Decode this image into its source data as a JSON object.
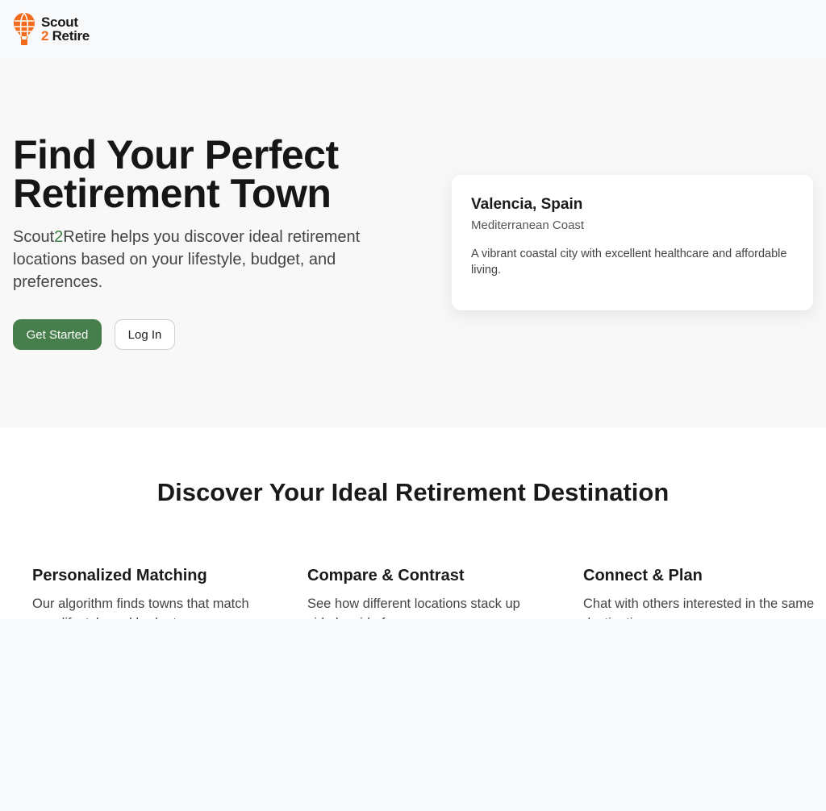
{
  "logo": {
    "line1": "Scout",
    "line2_num": "2",
    "line2_word": " Retire",
    "icon": "hot-air-balloon-icon",
    "colors": {
      "balloon": "#f26a1b"
    }
  },
  "hero": {
    "title": "Find Your Perfect Retirement Town",
    "subtitle_pre": "Scout",
    "subtitle_num": "2",
    "subtitle_post": "Retire helps you discover ideal retirement locations based on your lifestyle, budget, and preferences.",
    "primary_button": "Get Started",
    "secondary_button": "Log In",
    "colors": {
      "primary": "#467f4b"
    }
  },
  "card": {
    "title": "Valencia, Spain",
    "region": "Mediterranean Coast",
    "description": "A vibrant coastal city with excellent healthcare and affordable living."
  },
  "features": {
    "title": "Discover Your Ideal Retirement Destination",
    "items": [
      {
        "title": "Personalized Matching",
        "text": "Our algorithm finds towns that match your lifestyle and budget."
      },
      {
        "title": "Compare & Contrast",
        "text": "See how different locations stack up side by side for you."
      },
      {
        "title": "Connect & Plan",
        "text": "Chat with others interested in the same destinations."
      }
    ]
  }
}
